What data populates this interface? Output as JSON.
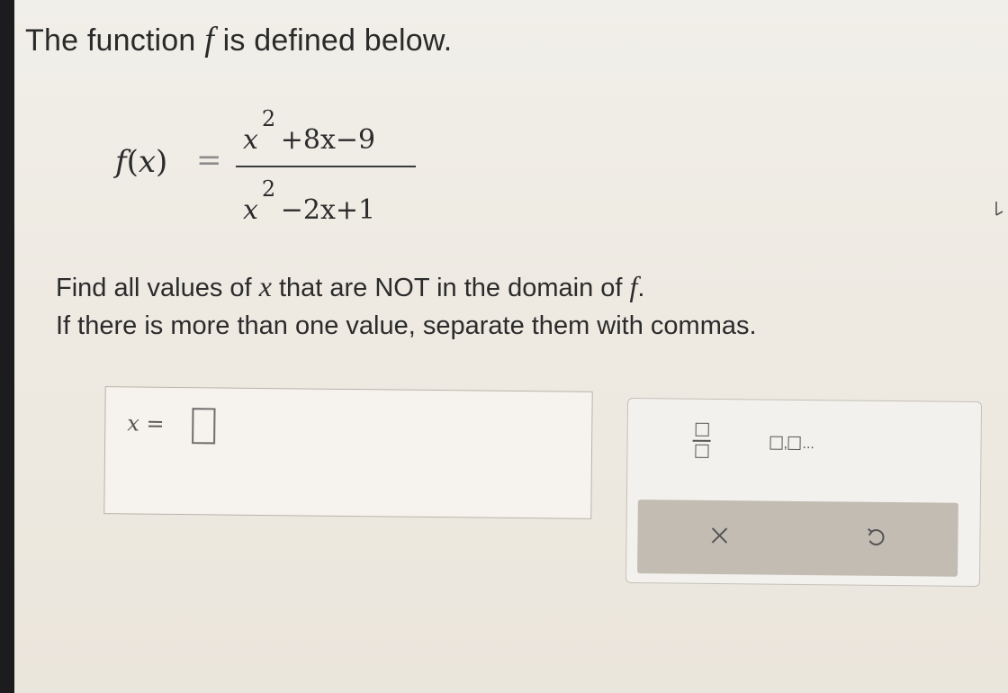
{
  "prompt": {
    "title_before": "The function",
    "title_var": "f",
    "title_after": "is defined below."
  },
  "formula": {
    "lhs_f": "f",
    "lhs_open": "(",
    "lhs_x": "x",
    "lhs_close": ")",
    "equals": "=",
    "numerator": {
      "var": "x",
      "exp": "2",
      "rest": " +8x−9"
    },
    "denominator": {
      "var": "x",
      "exp": "2",
      "rest": " −2x+1"
    }
  },
  "instructions": {
    "line1_before": "Find all values of",
    "line1_var": "x",
    "line1_middle": "that are NOT in the domain of",
    "line1_fvar": "f",
    "line1_end": ".",
    "line2": "If there is more than one value, separate them with commas."
  },
  "answer": {
    "label_var": "x",
    "label_eq": " =",
    "value": ""
  },
  "keypad": {
    "list_dots": "...",
    "list_comma": ","
  },
  "icons": {
    "fraction": "fraction-icon",
    "list": "list-icon",
    "clear": "close-icon",
    "undo": "undo-icon",
    "cursor": "mouse-cursor-icon"
  }
}
